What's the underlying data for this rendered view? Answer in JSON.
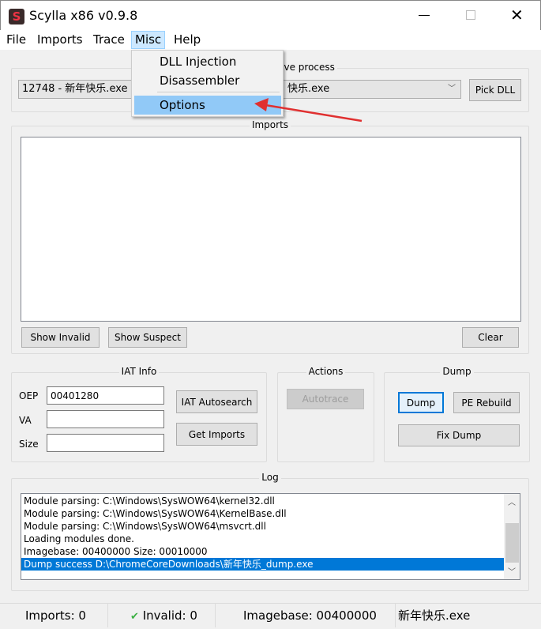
{
  "window": {
    "title": "Scylla x86 v0.9.8",
    "controls": [
      "minimize",
      "maximize",
      "close"
    ]
  },
  "menubar": [
    "File",
    "Imports",
    "Trace",
    "Misc",
    "Help"
  ],
  "misc_menu": {
    "items": [
      "DLL Injection",
      "Disassembler",
      "Options"
    ],
    "highlighted": "Options"
  },
  "process": {
    "group_label": "Attach to an active process",
    "selected_left": "12748 - 新年快乐.exe - ",
    "selected_right": "快乐.exe",
    "pick_dll": "Pick DLL"
  },
  "imports": {
    "group_label": "Imports",
    "show_invalid": "Show Invalid",
    "show_suspect": "Show Suspect",
    "clear": "Clear"
  },
  "iat_info": {
    "group_label": "IAT Info",
    "oep_label": "OEP",
    "oep_value": "00401280",
    "va_label": "VA",
    "va_value": "",
    "size_label": "Size",
    "size_value": "",
    "iat_autosearch": "IAT Autosearch",
    "get_imports": "Get Imports"
  },
  "actions": {
    "group_label": "Actions",
    "autotrace": "Autotrace"
  },
  "dump": {
    "group_label": "Dump",
    "dump": "Dump",
    "pe_rebuild": "PE Rebuild",
    "fix_dump": "Fix Dump"
  },
  "log": {
    "group_label": "Log",
    "lines": [
      "Module parsing: C:\\Windows\\SysWOW64\\kernel32.dll",
      "Module parsing: C:\\Windows\\SysWOW64\\KernelBase.dll",
      "Module parsing: C:\\Windows\\SysWOW64\\msvcrt.dll",
      "Loading modules done.",
      "Imagebase: 00400000 Size: 00010000",
      "Dump success D:\\ChromeCoreDownloads\\新年快乐_dump.exe"
    ],
    "selected_index": 5
  },
  "statusbar": {
    "imports": "Imports: 0",
    "invalid": "Invalid: 0",
    "imagebase": "Imagebase: 00400000",
    "module": "新年快乐.exe"
  },
  "colors": {
    "selection": "#0078d7",
    "menu_highlight": "#91c9f7",
    "annotation_arrow": "#e03030",
    "check": "#3cb043"
  }
}
